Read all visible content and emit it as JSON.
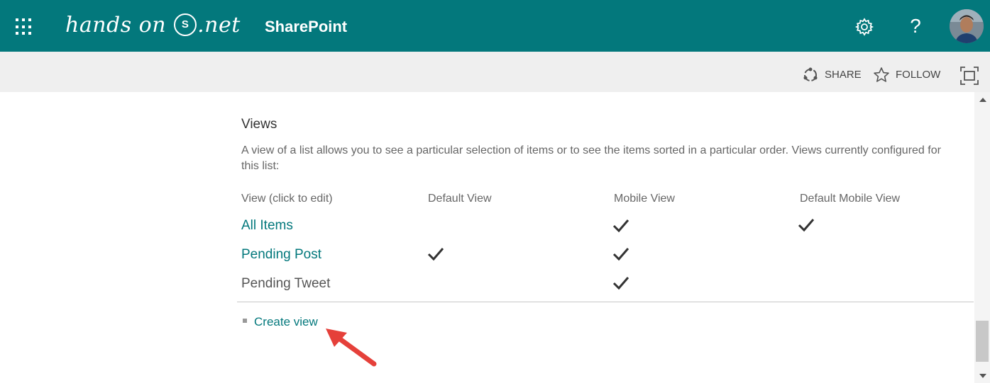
{
  "header": {
    "logo_text": "hands on",
    "logo_mark": "S",
    "logo_suffix": ".net",
    "app_title": "SharePoint",
    "help_label": "?",
    "icons": [
      "app-launcher-icon",
      "settings-gear-icon",
      "help-icon",
      "user-avatar"
    ],
    "accent_color": "#03787c"
  },
  "actions": {
    "share_label": "SHARE",
    "follow_label": "FOLLOW"
  },
  "views": {
    "title": "Views",
    "description": "A view of a list allows you to see a particular selection of items or to see the items sorted in a particular order. Views currently configured for this list:",
    "columns": [
      "View (click to edit)",
      "Default View",
      "Mobile View",
      "Default Mobile View"
    ],
    "rows": [
      {
        "name": "All Items",
        "default_view": false,
        "mobile_view": true,
        "default_mobile_view": true
      },
      {
        "name": "Pending Post",
        "default_view": true,
        "mobile_view": true,
        "default_mobile_view": false
      },
      {
        "name": "Pending Tweet",
        "default_view": false,
        "mobile_view": true,
        "default_mobile_view": false
      }
    ],
    "create_view_label": "Create view"
  },
  "annotation": {
    "arrow_color": "#e5403a"
  }
}
